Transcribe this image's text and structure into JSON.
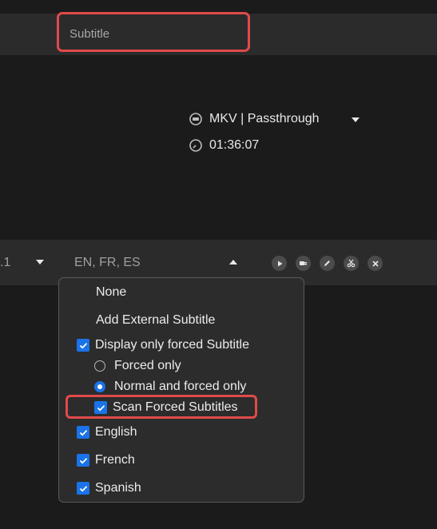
{
  "subtitle_field": {
    "placeholder": "Subtitle"
  },
  "output": {
    "container_label": "MKV | Passthrough",
    "duration": "01:36:07"
  },
  "subtitle_track": {
    "number_fragment": ".1",
    "languages": "EN, FR, ES"
  },
  "track_actions": [
    "play-icon",
    "plugin-icon",
    "edit-icon",
    "cut-icon",
    "close-icon"
  ],
  "menu": {
    "none": "None",
    "add_external": "Add External Subtitle",
    "display_forced": {
      "label": "Display only forced Subtitle",
      "checked": true
    },
    "forced_only": {
      "label": "Forced only",
      "selected": false
    },
    "normal_and_forced": {
      "label": "Normal and forced only",
      "selected": true
    },
    "scan_forced": {
      "label": "Scan Forced Subtitles",
      "checked": true
    },
    "languages": [
      {
        "label": "English",
        "checked": true
      },
      {
        "label": "French",
        "checked": true
      },
      {
        "label": "Spanish",
        "checked": true
      }
    ]
  },
  "colors": {
    "highlight": "#e04a4a",
    "accent": "#1a73e8",
    "panel": "#2b2b2b",
    "background": "#1b1b1b"
  }
}
